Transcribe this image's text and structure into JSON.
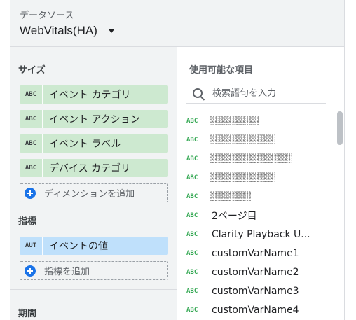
{
  "datasource": {
    "label": "データソース",
    "name": "WebVitals(HA)"
  },
  "dimensions": {
    "title": "サイズ",
    "items": [
      {
        "type": "ABC",
        "label": "イベント カテゴリ"
      },
      {
        "type": "ABC",
        "label": "イベント アクション"
      },
      {
        "type": "ABC",
        "label": "イベント ラベル"
      },
      {
        "type": "ABC",
        "label": "デバイス カテゴリ"
      }
    ],
    "add_label": "ディメンションを追加"
  },
  "metrics": {
    "title": "指標",
    "items": [
      {
        "type": "AUT",
        "label": "イベントの値"
      }
    ],
    "add_label": "指標を追加"
  },
  "period": {
    "title": "期間"
  },
  "available": {
    "title": "使用可能な項目",
    "search_placeholder": "検索語句を入力",
    "type_label": "ABC",
    "fields": [
      {
        "type": "ABC",
        "name": ""
      },
      {
        "type": "ABC",
        "name": ""
      },
      {
        "type": "ABC",
        "name": ""
      },
      {
        "type": "ABC",
        "name": ""
      },
      {
        "type": "ABC",
        "name": ""
      },
      {
        "type": "ABC",
        "name": "2ページ目"
      },
      {
        "type": "ABC",
        "name": "Clarity Playback U..."
      },
      {
        "type": "ABC",
        "name": "customVarName1"
      },
      {
        "type": "ABC",
        "name": "customVarName2"
      },
      {
        "type": "ABC",
        "name": "customVarName3"
      },
      {
        "type": "ABC",
        "name": "customVarName4"
      }
    ]
  },
  "colors": {
    "dimension_chip": "#cde9d0",
    "metric_chip": "#bfe0fb",
    "accent": "#1a73e8",
    "field_type": "#34a853"
  }
}
